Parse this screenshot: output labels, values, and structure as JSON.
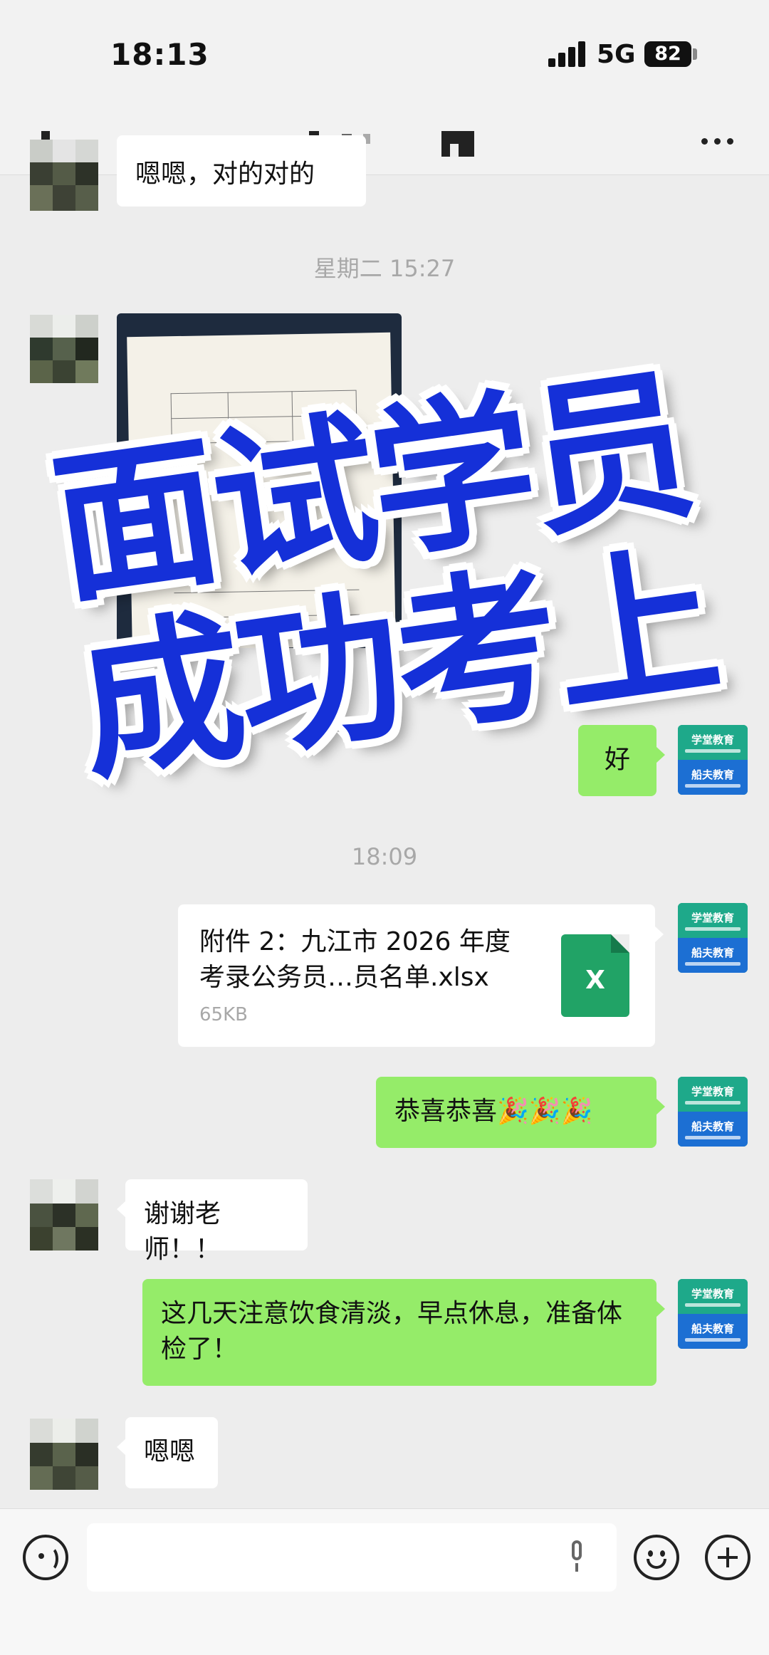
{
  "status_bar": {
    "time": "18:13",
    "network": "5G",
    "battery": "82"
  },
  "chat": {
    "partial_message": "嗯嗯，对的对的",
    "timestamps": [
      "星期二 15:27",
      "18:09"
    ],
    "messages": [
      {
        "side": "self",
        "text": "好"
      },
      {
        "side": "self",
        "type": "file",
        "file_name": "附件 2：九江市 2026 年度考录公务员…员名单.xlsx",
        "file_size": "65KB",
        "file_type": "X"
      },
      {
        "side": "self",
        "text": "恭喜恭喜🎉🎉🎉"
      },
      {
        "side": "other",
        "text": "谢谢老师！！"
      },
      {
        "side": "self",
        "text": "这几天注意饮食清淡，早点休息，准备体检了！"
      },
      {
        "side": "other",
        "text": "嗯嗯"
      }
    ],
    "self_avatar": {
      "top_label": "学堂教育",
      "bottom_label": "船夫教育"
    }
  },
  "overlay": {
    "line1": "面试学员",
    "line2": "成功考上",
    "color": "#1530d8"
  },
  "input_bar": {
    "placeholder": ""
  },
  "colors": {
    "self_bubble": "#95ec69",
    "other_bubble": "#ffffff",
    "background": "#ededed"
  }
}
